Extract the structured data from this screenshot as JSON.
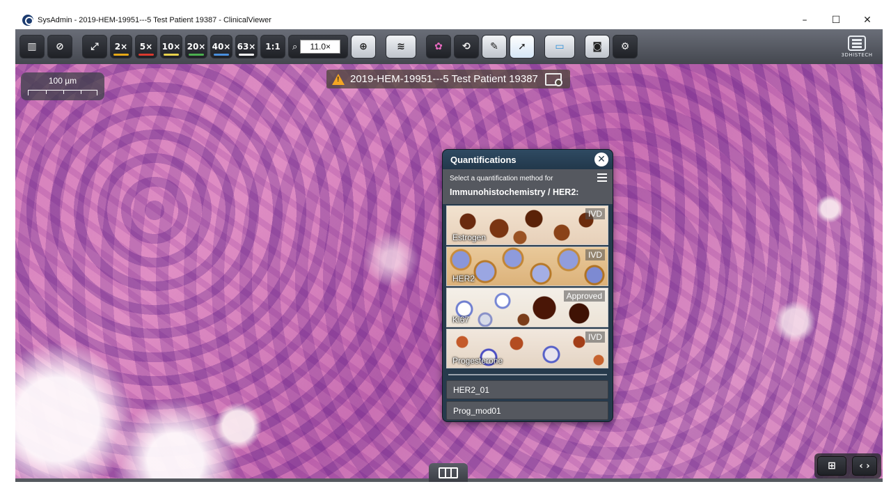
{
  "window": {
    "title": "SysAdmin - 2019-HEM-19951---5 Test Patient 19387 - ClinicalViewer",
    "minimize": "–",
    "maximize": "☐",
    "close": "✕"
  },
  "toolbar": {
    "buttons": [
      {
        "name": "slide-tray-button",
        "glyph": "▥"
      },
      {
        "name": "navigator-button",
        "glyph": "⊘"
      },
      {
        "name": "fit-to-screen-button",
        "glyph": "⤢"
      }
    ],
    "zoom_levels": [
      {
        "label": "2×",
        "color": "#e6a817"
      },
      {
        "label": "5×",
        "color": "#d93a2f"
      },
      {
        "label": "10×",
        "color": "#e9d24c"
      },
      {
        "label": "20×",
        "color": "#4caf50"
      },
      {
        "label": "40×",
        "color": "#4a8fdd"
      },
      {
        "label": "63×",
        "color": "#ffffff"
      }
    ],
    "one_to_one": "1:1",
    "zoom_value": "11.0×",
    "logo_text": "3DHISTECH"
  },
  "scalebar": {
    "label": "100 µm"
  },
  "slide_label": {
    "text": "2019-HEM-19951---5 Test Patient 19387"
  },
  "quant_panel": {
    "title": "Quantifications",
    "close": "✕",
    "subtitle": "Select a quantification method for",
    "context": "Immunohistochemistry / HER2:",
    "methods": [
      {
        "name": "Estrogen",
        "badge": "IVD"
      },
      {
        "name": "HER2",
        "badge": "IVD"
      },
      {
        "name": "Ki67",
        "badge": "Approved"
      },
      {
        "name": "Progesterone",
        "badge": "IVD"
      }
    ],
    "models": [
      "HER2_01",
      "Prog_mod01"
    ]
  }
}
